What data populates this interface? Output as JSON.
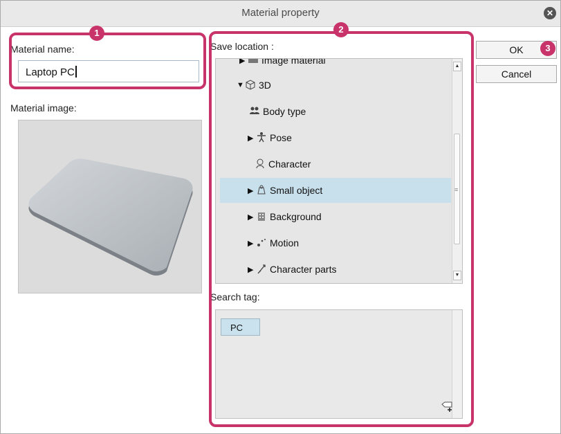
{
  "window": {
    "title": "Material property"
  },
  "material": {
    "name_label": "Material name:",
    "name_value": "Laptop PC",
    "image_label": "Material image:"
  },
  "save_location": {
    "label": "Save location :",
    "partial_item": "Image material",
    "items": [
      {
        "label": "3D",
        "icon": "cube-icon",
        "expanded": true
      },
      {
        "label": "Body type",
        "icon": "people-icon"
      },
      {
        "label": "Pose",
        "icon": "figure-icon"
      },
      {
        "label": "Character",
        "icon": "character-icon"
      },
      {
        "label": "Small object",
        "icon": "small-object-icon",
        "selected": true
      },
      {
        "label": "Background",
        "icon": "building-icon"
      },
      {
        "label": "Motion",
        "icon": "motion-icon"
      },
      {
        "label": "Character parts",
        "icon": "character-parts-icon"
      }
    ]
  },
  "search_tag": {
    "label": "Search tag:",
    "tags": [
      "PC"
    ]
  },
  "buttons": {
    "ok": "OK",
    "cancel": "Cancel"
  },
  "annotations": [
    "1",
    "2",
    "3"
  ],
  "colors": {
    "highlight": "#c8336a",
    "selection": "#c8e0ec"
  }
}
